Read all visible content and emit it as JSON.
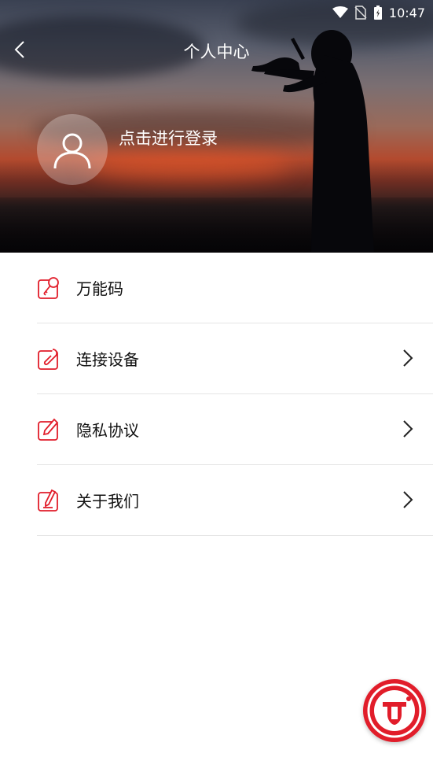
{
  "status_bar": {
    "time": "10:47"
  },
  "header": {
    "title": "个人中心"
  },
  "profile": {
    "login_prompt": "点击进行登录"
  },
  "menu": [
    {
      "label": "万能码",
      "has_arrow": false
    },
    {
      "label": "连接设备",
      "has_arrow": true
    },
    {
      "label": "隐私协议",
      "has_arrow": true
    },
    {
      "label": "关于我们",
      "has_arrow": true
    }
  ],
  "colors": {
    "accent": "#e11d2a",
    "divider": "#e5e5e5",
    "text": "#111111"
  },
  "icons": {
    "back": "chevron-left-icon",
    "avatar": "user-icon",
    "fab": "brand-logo-icon"
  }
}
